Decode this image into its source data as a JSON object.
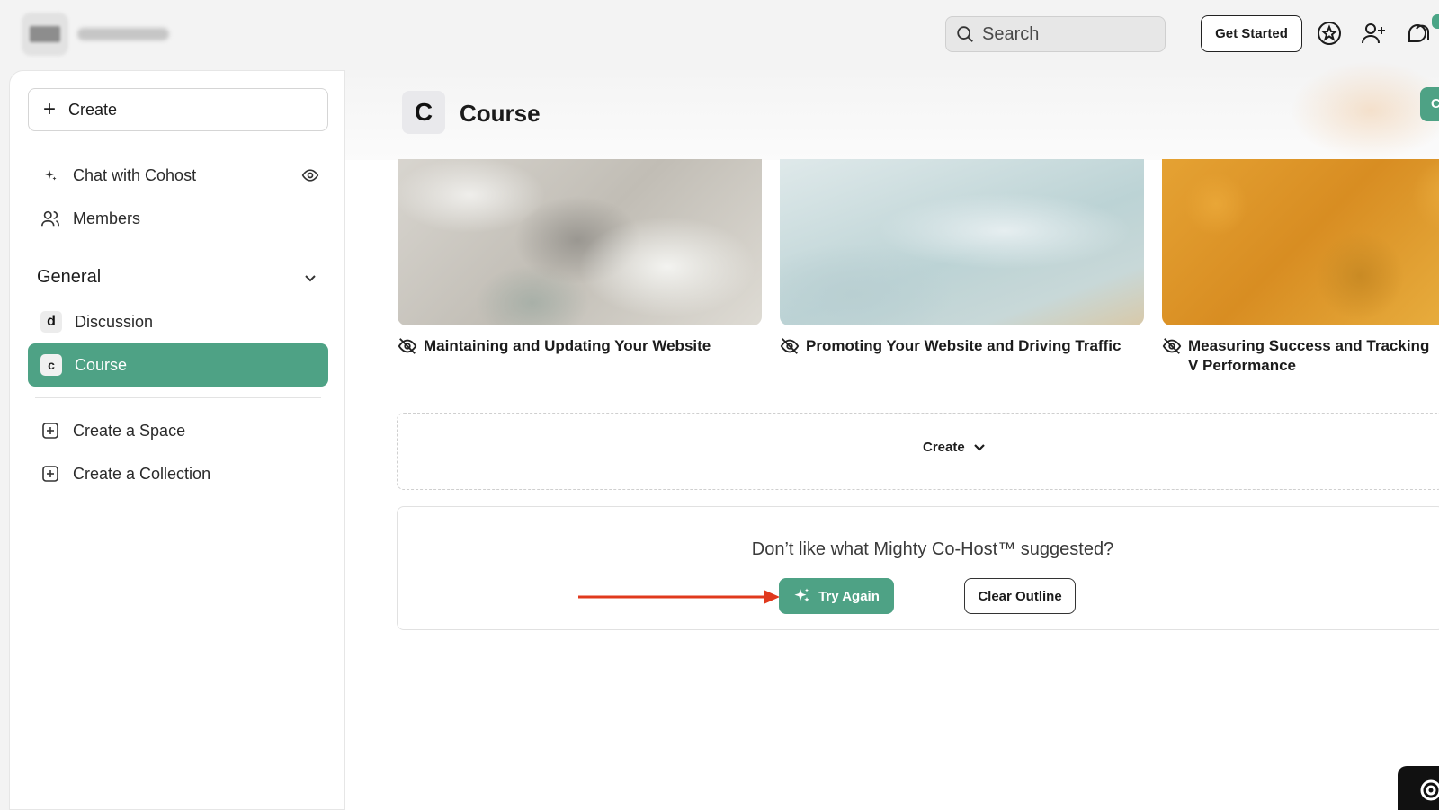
{
  "colors": {
    "accent": "#4ea285",
    "annotation_arrow": "#e0391d"
  },
  "topbar": {
    "search_placeholder": "Search",
    "get_started_label": "Get Started",
    "icons": [
      "search-icon",
      "star-badge-icon",
      "add-member-icon",
      "chat-icon"
    ]
  },
  "sidebar": {
    "create_label": "Create",
    "items": [
      {
        "label": "Chat with Cohost",
        "icon": "sparkle-icon"
      },
      {
        "label": "Members",
        "icon": "members-icon"
      }
    ],
    "section_title": "General",
    "spaces": [
      {
        "badge": "d",
        "label": "Discussion"
      },
      {
        "badge": "c",
        "label": "Course",
        "active": true
      }
    ],
    "actions": [
      {
        "label": "Create a Space",
        "icon": "plus-square-icon"
      },
      {
        "label": "Create a Collection",
        "icon": "plus-square-icon"
      }
    ]
  },
  "main": {
    "page_badge": "C",
    "page_title": "Course",
    "header_action_label": "C",
    "cards": [
      {
        "title": "Maintaining and Updating Your Website",
        "image": "clouds"
      },
      {
        "title": "Promoting Your Website and Driving Traffic",
        "image": "silk"
      },
      {
        "title": "Measuring Success and Tracking V Performance",
        "image": "gold"
      }
    ],
    "create_dropdown_label": "Create",
    "suggestion_text": "Don’t like what Mighty Co-Host™ suggested?",
    "try_again_label": "Try Again",
    "clear_outline_label": "Clear Outline"
  }
}
